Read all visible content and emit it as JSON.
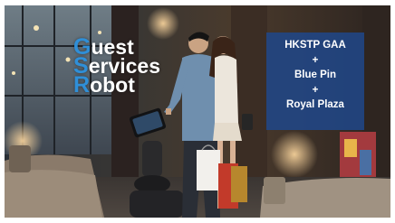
{
  "title": {
    "lines": [
      {
        "initial": "G",
        "rest": "uest"
      },
      {
        "initial": "S",
        "rest": "ervices"
      },
      {
        "initial": "R",
        "rest": "obot"
      }
    ]
  },
  "partners": [
    "HKSTP GAA",
    "+",
    "Blue Pin",
    "+",
    "Royal Plaza"
  ],
  "colors": {
    "initial_accent": "#2f8fd8",
    "partner_box": "#1f478b",
    "text": "#ffffff"
  }
}
